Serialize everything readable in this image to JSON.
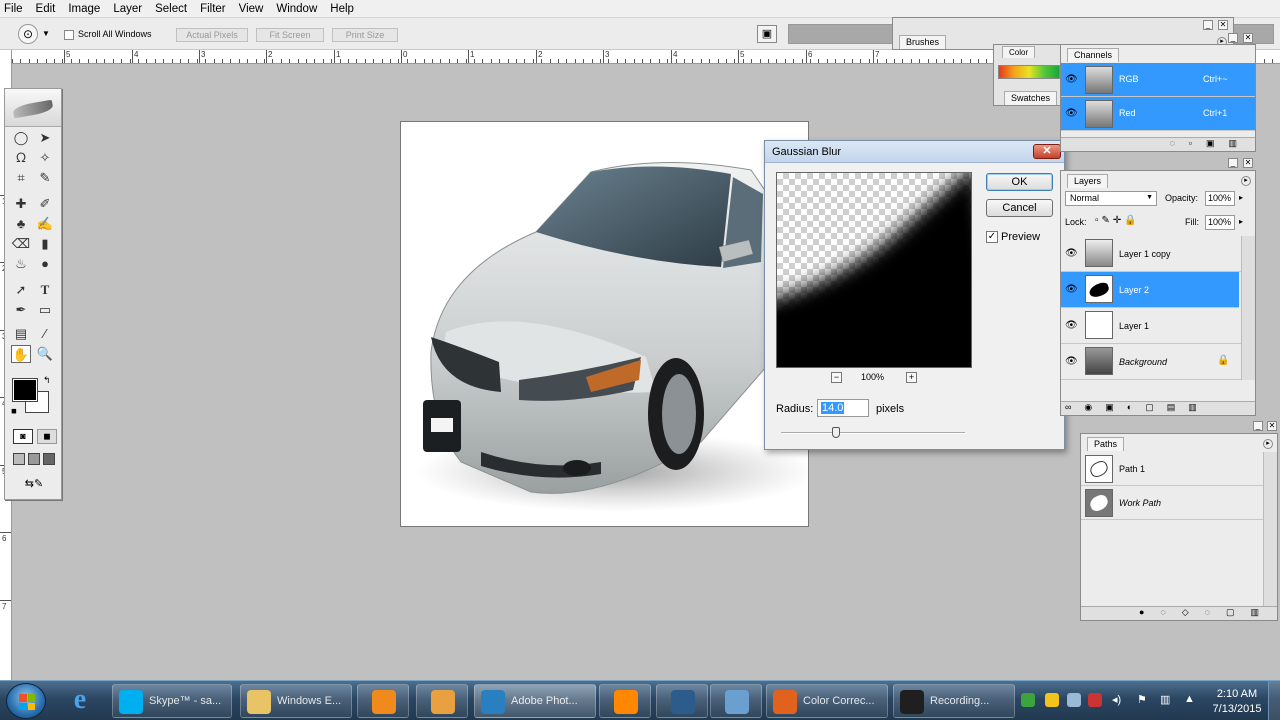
{
  "menu": [
    "File",
    "Edit",
    "Image",
    "Layer",
    "Select",
    "Filter",
    "View",
    "Window",
    "Help"
  ],
  "options_bar": {
    "scroll_all_windows": "Scroll All Windows",
    "actual_pixels": "Actual Pixels",
    "fit_screen": "Fit Screen",
    "print_size": "Print Size"
  },
  "ruler_h_labels": [
    "5",
    "4",
    "3",
    "2",
    "1",
    "0",
    "1",
    "2",
    "3",
    "4",
    "5",
    "6",
    "7"
  ],
  "ruler_v_labels": [
    "1",
    "2",
    "3",
    "4",
    "5",
    "6",
    "7"
  ],
  "brushes_panel": {
    "tab": "Brushes"
  },
  "color_panel": {
    "tab": "Color",
    "swatches_tab": "Swatches"
  },
  "channels_panel": {
    "tab": "Channels",
    "rows": [
      {
        "name": "RGB",
        "shortcut": "Ctrl+~"
      },
      {
        "name": "Red",
        "shortcut": "Ctrl+1"
      }
    ]
  },
  "layers_panel": {
    "tab": "Layers",
    "blend_mode": "Normal",
    "opacity_label": "Opacity:",
    "opacity": "100%",
    "lock_label": "Lock:",
    "fill_label": "Fill:",
    "fill": "100%",
    "layers": [
      {
        "name": "Layer 1 copy",
        "selected": false
      },
      {
        "name": "Layer 2",
        "selected": true
      },
      {
        "name": "Layer 1",
        "selected": false
      },
      {
        "name": "Background",
        "selected": false
      }
    ]
  },
  "paths_panel": {
    "tab": "Paths",
    "paths": [
      {
        "name": "Path 1"
      },
      {
        "name": "Work Path"
      }
    ]
  },
  "gaussian_blur": {
    "title": "Gaussian Blur",
    "ok": "OK",
    "cancel": "Cancel",
    "preview_label": "Preview",
    "preview_checked": true,
    "zoom": "100%",
    "zoom_minus": "−",
    "zoom_plus": "+",
    "radius_label": "Radius:",
    "radius_value": "14.0",
    "radius_unit": "pixels",
    "slider_level": 0.3
  },
  "taskbar": {
    "items": [
      {
        "label": "Skype™ - sa...",
        "color": "#00aff0"
      },
      {
        "label": "Windows E...",
        "color": "#e8c466"
      },
      {
        "label": "",
        "color": "#f08a1c"
      },
      {
        "label": "",
        "color": "#e8a040"
      },
      {
        "label": "Adobe Phot...",
        "color": "#2a7fc0"
      },
      {
        "label": "",
        "color": "#ff8800"
      },
      {
        "label": "",
        "color": "#2c5c8c"
      },
      {
        "label": "",
        "color": "#6aa0d0"
      },
      {
        "label": "Color Correc...",
        "color": "#e0621e"
      },
      {
        "label": "Recording...",
        "color": "#1f1f1f"
      }
    ],
    "time": "2:10 AM",
    "date": "7/13/2015"
  },
  "colors": {
    "selection": "#3399ff",
    "taskbar": "#2b4663",
    "dialog_title": "#c3d5ec"
  }
}
